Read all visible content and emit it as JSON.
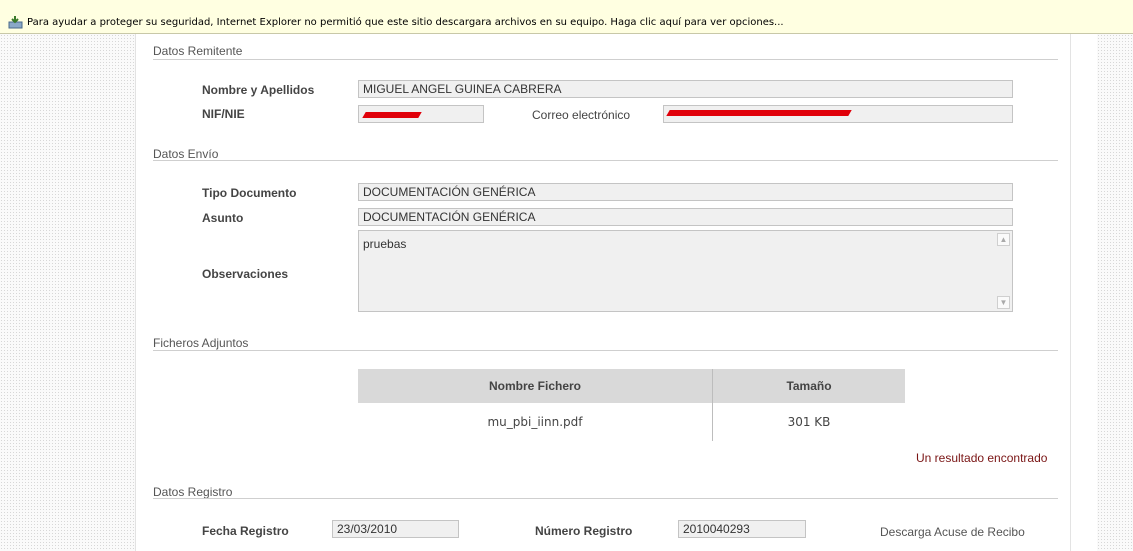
{
  "infobar": {
    "text": "Para ayudar a proteger su seguridad, Internet Explorer no permitió que este sitio descargara archivos en su equipo. Haga clic aquí para ver opciones..."
  },
  "remitente": {
    "title": "Datos Remitente",
    "nombre_label": "Nombre y Apellidos",
    "nombre_value": "MIGUEL ANGEL GUINEA CABRERA",
    "nif_label": "NIF/NIE",
    "nif_value": "",
    "correo_label": "Correo electrónico",
    "correo_value": ""
  },
  "envio": {
    "title": "Datos Envío",
    "tipo_label": "Tipo Documento",
    "tipo_value": "DOCUMENTACIÓN GENÉRICA",
    "asunto_label": "Asunto",
    "asunto_value": "DOCUMENTACIÓN GENÉRICA",
    "observaciones_label": "Observaciones",
    "observaciones_value": "pruebas"
  },
  "adjuntos": {
    "title": "Ficheros Adjuntos",
    "columns": [
      "Nombre Fichero",
      "Tamaño"
    ],
    "rows": [
      {
        "nombre": "mu_pbi_iinn.pdf",
        "tamano": "301 KB"
      }
    ],
    "result_text": "Un resultado encontrado"
  },
  "registro": {
    "title": "Datos Registro",
    "fecha_label": "Fecha Registro",
    "fecha_value": "23/03/2010",
    "numero_label": "Número Registro",
    "numero_value": "2010040293",
    "acuse_link": "Descarga Acuse de Recibo"
  },
  "colors": {
    "redaction": "#e0000a",
    "result_text": "#7a1515",
    "infobar_bg": "#ffffe1"
  }
}
